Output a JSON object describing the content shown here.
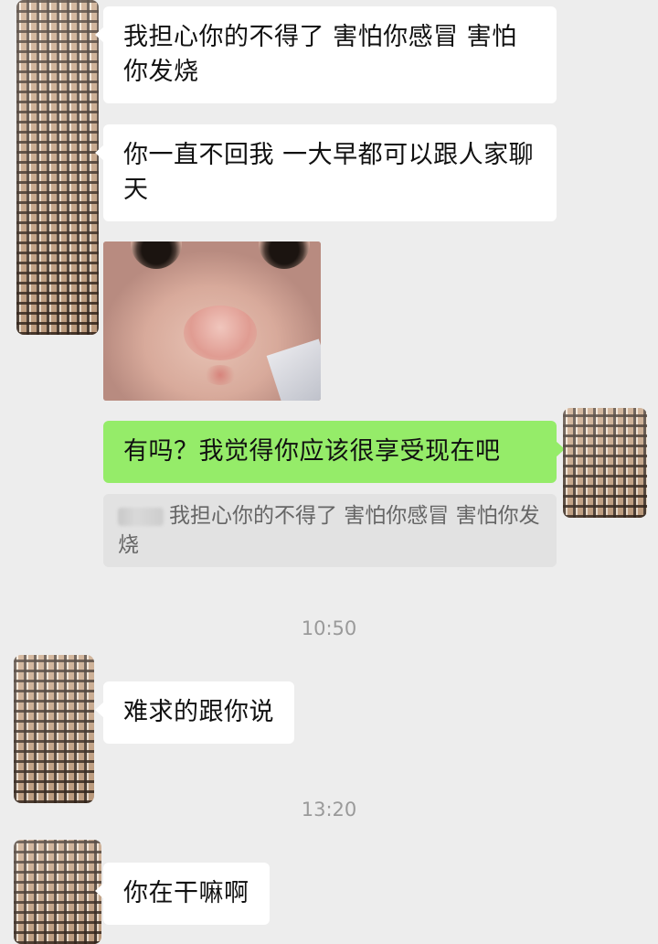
{
  "messages": [
    {
      "text": "我担心你的不得了 害怕你感冒 害怕你发烧"
    },
    {
      "text": "你一直不回我 一大早都可以跟人家聊天"
    },
    {
      "image": "crying-baby-sticker"
    },
    {
      "text": "有吗？我觉得你应该很享受现在吧",
      "quote": "我担心你的不得了 害怕你感冒 害怕你发烧"
    }
  ],
  "time_1": "10:50",
  "message_after_1": "难求的跟你说",
  "time_2": "13:20",
  "message_after_2": "你在干嘛啊",
  "colors": {
    "background": "#ededed",
    "incoming_bubble": "#ffffff",
    "outgoing_bubble": "#95ec69",
    "quote_background": "#e2e2e2",
    "timestamp": "#9a9a9a"
  }
}
